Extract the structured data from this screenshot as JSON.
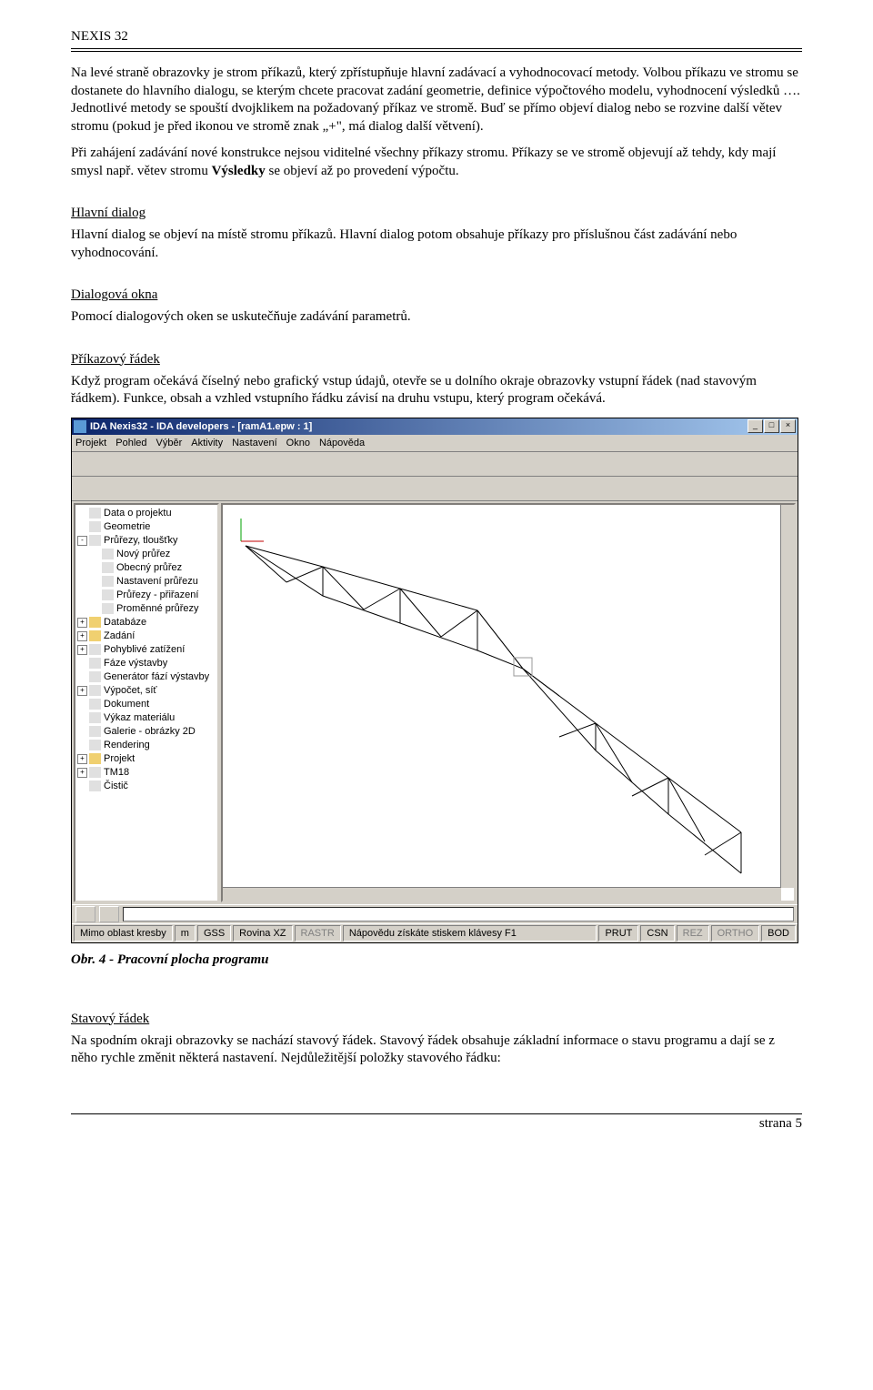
{
  "doc_title": "NEXIS 32",
  "body": {
    "p1": "Na levé straně obrazovky je strom příkazů, který zpřístupňuje hlavní zadávací a vyhodnocovací metody. Volbou příkazu ve stromu se dostanete do hlavního dialogu, se kterým chcete pracovat zadání geometrie, definice výpočtového modelu, vyhodnocení výsledků …. Jednotlivé metody se spouští dvojklikem na požadovaný příkaz ve stromě. Buď se přímo objeví dialog nebo se rozvine další větev stromu (pokud je před ikonou ve stromě znak „+\", má dialog další větvení).",
    "p2a": "Při zahájení zadávání nové konstrukce nejsou viditelné všechny příkazy stromu. Příkazy se ve stromě objevují až tehdy, kdy mají smysl např. větev stromu ",
    "p2b": "Výsledky",
    "p2c": " se objeví až po provedení výpočtu.",
    "h1": "Hlavní dialog",
    "p3": "Hlavní dialog se objeví na místě stromu příkazů. Hlavní dialog potom obsahuje příkazy pro příslušnou část zadávání nebo vyhodnocování.",
    "h2": "Dialogová okna",
    "p4": "Pomocí dialogových oken se uskutečňuje zadávání parametrů.",
    "h3": "Příkazový řádek",
    "p5": "Když program očekává číselný nebo grafický vstup údajů, otevře se u dolního okraje obrazovky vstupní řádek (nad stavovým řádkem). Funkce, obsah a vzhled vstupního řádku závisí na druhu vstupu, který program očekává.",
    "caption": "Obr. 4 - Pracovní plocha programu",
    "h4": "Stavový řádek",
    "p6": "Na spodním okraji obrazovky se nachází stavový řádek. Stavový řádek obsahuje základní informace o stavu programu a dají se z něho rychle změnit některá nastavení. Nejdůležitější položky stavového řádku:"
  },
  "app": {
    "title": "IDA Nexis32 - IDA developers - [ramA1.epw : 1]",
    "menu": [
      "Projekt",
      "Pohled",
      "Výběr",
      "Aktivity",
      "Nastavení",
      "Okno",
      "Nápověda"
    ],
    "tree": [
      {
        "indent": 0,
        "toggle": "",
        "icon": "doc",
        "label": "Data o projektu"
      },
      {
        "indent": 0,
        "toggle": "",
        "icon": "doc",
        "label": "Geometrie"
      },
      {
        "indent": 0,
        "toggle": "-",
        "icon": "doc",
        "label": "Průřezy, tloušťky"
      },
      {
        "indent": 1,
        "toggle": "",
        "icon": "doc",
        "label": "Nový průřez"
      },
      {
        "indent": 1,
        "toggle": "",
        "icon": "doc",
        "label": "Obecný průřez"
      },
      {
        "indent": 1,
        "toggle": "",
        "icon": "doc",
        "label": "Nastavení průřezu"
      },
      {
        "indent": 1,
        "toggle": "",
        "icon": "doc",
        "label": "Průřezy - přiřazení"
      },
      {
        "indent": 1,
        "toggle": "",
        "icon": "doc",
        "label": "Proměnné průřezy"
      },
      {
        "indent": 0,
        "toggle": "+",
        "icon": "folder",
        "label": "Databáze"
      },
      {
        "indent": 0,
        "toggle": "+",
        "icon": "folder",
        "label": "Zadání"
      },
      {
        "indent": 0,
        "toggle": "+",
        "icon": "doc",
        "label": "Pohyblivé zatížení"
      },
      {
        "indent": 0,
        "toggle": "",
        "icon": "doc",
        "label": "Fáze výstavby"
      },
      {
        "indent": 0,
        "toggle": "",
        "icon": "doc",
        "label": "Generátor fází výstavby"
      },
      {
        "indent": 0,
        "toggle": "+",
        "icon": "doc",
        "label": "Výpočet, síť"
      },
      {
        "indent": 0,
        "toggle": "",
        "icon": "doc",
        "label": "Dokument"
      },
      {
        "indent": 0,
        "toggle": "",
        "icon": "doc",
        "label": "Výkaz materiálu"
      },
      {
        "indent": 0,
        "toggle": "",
        "icon": "doc",
        "label": "Galerie - obrázky 2D"
      },
      {
        "indent": 0,
        "toggle": "",
        "icon": "doc",
        "label": "Rendering"
      },
      {
        "indent": 0,
        "toggle": "+",
        "icon": "folder",
        "label": "Projekt"
      },
      {
        "indent": 0,
        "toggle": "+",
        "icon": "doc",
        "label": "TM18"
      },
      {
        "indent": 0,
        "toggle": "",
        "icon": "doc",
        "label": "Čistič"
      }
    ],
    "status": {
      "s1": "Mimo oblast kresby",
      "s2": "m",
      "s3": "GSS",
      "s4": "Rovina XZ",
      "s5": "RASTR",
      "s6": "Nápovědu získáte stiskem klávesy F1",
      "s7": "PRUT",
      "s8": "CSN",
      "s9": "REZ",
      "s10": "ORTHO",
      "s11": "BOD"
    }
  },
  "footer": "strana 5"
}
